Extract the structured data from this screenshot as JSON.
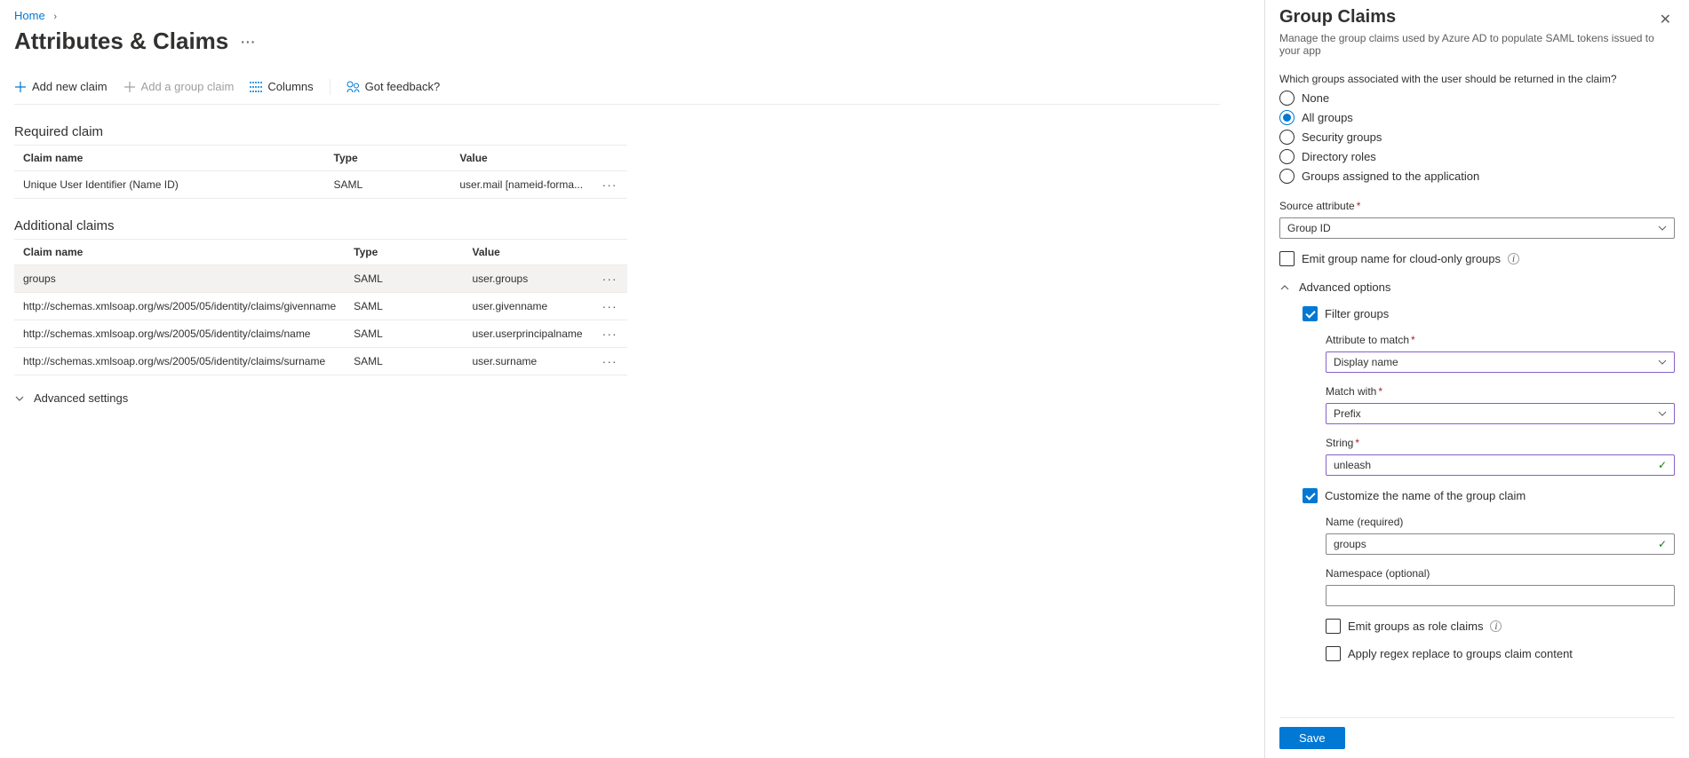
{
  "breadcrumb": {
    "home": "Home"
  },
  "page": {
    "title": "Attributes & Claims"
  },
  "toolbar": {
    "add_claim": "Add new claim",
    "add_group": "Add a group claim",
    "columns": "Columns",
    "feedback": "Got feedback?"
  },
  "sections": {
    "required": "Required claim",
    "additional": "Additional claims",
    "advanced_settings": "Advanced settings"
  },
  "tableHeaders": {
    "name": "Claim name",
    "type": "Type",
    "value": "Value"
  },
  "requiredClaims": [
    {
      "name": "Unique User Identifier (Name ID)",
      "type": "SAML",
      "value": "user.mail [nameid-forma..."
    }
  ],
  "additionalClaims": [
    {
      "name": "groups",
      "type": "SAML",
      "value": "user.groups",
      "hl": true
    },
    {
      "name": "http://schemas.xmlsoap.org/ws/2005/05/identity/claims/givenname",
      "type": "SAML",
      "value": "user.givenname"
    },
    {
      "name": "http://schemas.xmlsoap.org/ws/2005/05/identity/claims/name",
      "type": "SAML",
      "value": "user.userprincipalname"
    },
    {
      "name": "http://schemas.xmlsoap.org/ws/2005/05/identity/claims/surname",
      "type": "SAML",
      "value": "user.surname"
    }
  ],
  "flyout": {
    "title": "Group Claims",
    "subtitle": "Manage the group claims used by Azure AD to populate SAML tokens issued to your app",
    "question": "Which groups associated with the user should be returned in the claim?",
    "radios": {
      "none": "None",
      "all": "All groups",
      "security": "Security groups",
      "directory": "Directory roles",
      "assigned": "Groups assigned to the application"
    },
    "source_attr_label": "Source attribute",
    "source_attr_value": "Group ID",
    "emit_cloud": "Emit group name for cloud-only groups",
    "advanced": "Advanced options",
    "filter_groups": "Filter groups",
    "attr_match_label": "Attribute to match",
    "attr_match_value": "Display name",
    "match_with_label": "Match with",
    "match_with_value": "Prefix",
    "string_label": "String",
    "string_value": "unleash",
    "customize_name": "Customize the name of the group claim",
    "name_label": "Name (required)",
    "name_value": "groups",
    "namespace_label": "Namespace (optional)",
    "namespace_value": "",
    "emit_role": "Emit groups as role claims",
    "apply_regex": "Apply regex replace to groups claim content",
    "save": "Save"
  }
}
